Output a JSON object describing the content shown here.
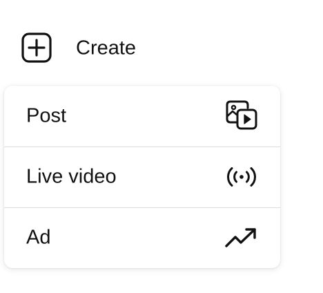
{
  "create": {
    "label": "Create",
    "icon": "plus-square-icon"
  },
  "menu": {
    "items": [
      {
        "label": "Post",
        "icon": "photo-video-icon"
      },
      {
        "label": "Live video",
        "icon": "live-broadcast-icon"
      },
      {
        "label": "Ad",
        "icon": "trending-up-icon"
      }
    ]
  },
  "colors": {
    "text": "#111111",
    "divider": "#dbdbdb",
    "menu_background": "#ffffff"
  }
}
